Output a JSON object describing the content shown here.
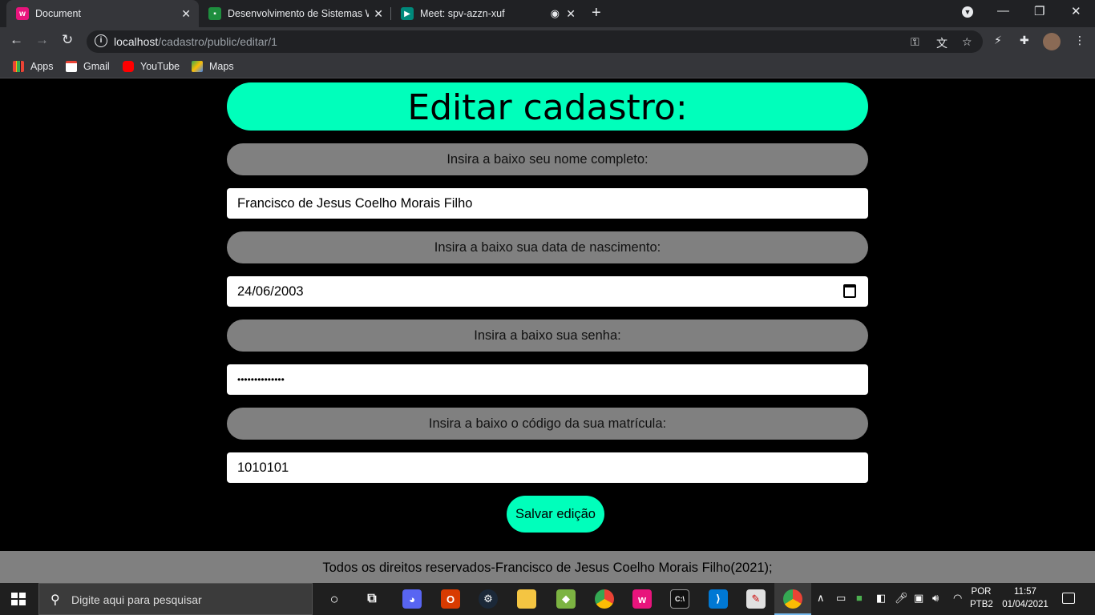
{
  "browser": {
    "tabs": [
      {
        "label": "Document",
        "favicon": "wamp-icon",
        "active": true
      },
      {
        "label": "Desenvolvimento de Sistemas W",
        "favicon": "classroom-icon",
        "active": false
      },
      {
        "label": "Meet: spv-azzn-xuf",
        "favicon": "meet-icon",
        "active": false
      }
    ],
    "url_host": "localhost",
    "url_path": "/cadastro/public/editar/1",
    "bookmarks": [
      {
        "label": "Apps"
      },
      {
        "label": "Gmail"
      },
      {
        "label": "YouTube"
      },
      {
        "label": "Maps"
      }
    ]
  },
  "page": {
    "heading": "Editar cadastro:",
    "fields": [
      {
        "label": "Insira a baixo seu nome completo:",
        "value": "Francisco de Jesus Coelho Morais Filho"
      },
      {
        "label": "Insira a baixo sua data de nascimento:",
        "value": "24/06/2003"
      },
      {
        "label": "Insira a baixo sua senha:",
        "value": "••••••••••••••"
      },
      {
        "label": "Insira a baixo o código da sua matrícula:",
        "value": "1010101"
      }
    ],
    "save_button": "Salvar edição",
    "footer": "Todos os direitos reservados-Francisco de Jesus Coelho Morais Filho(2021);"
  },
  "taskbar": {
    "search_placeholder": "Digite aqui para pesquisar",
    "lang_top": "POR",
    "lang_bottom": "PTB2",
    "time": "11:57",
    "date": "01/04/2021"
  },
  "colors": {
    "accent": "#00ffbb",
    "pill": "#808080"
  }
}
